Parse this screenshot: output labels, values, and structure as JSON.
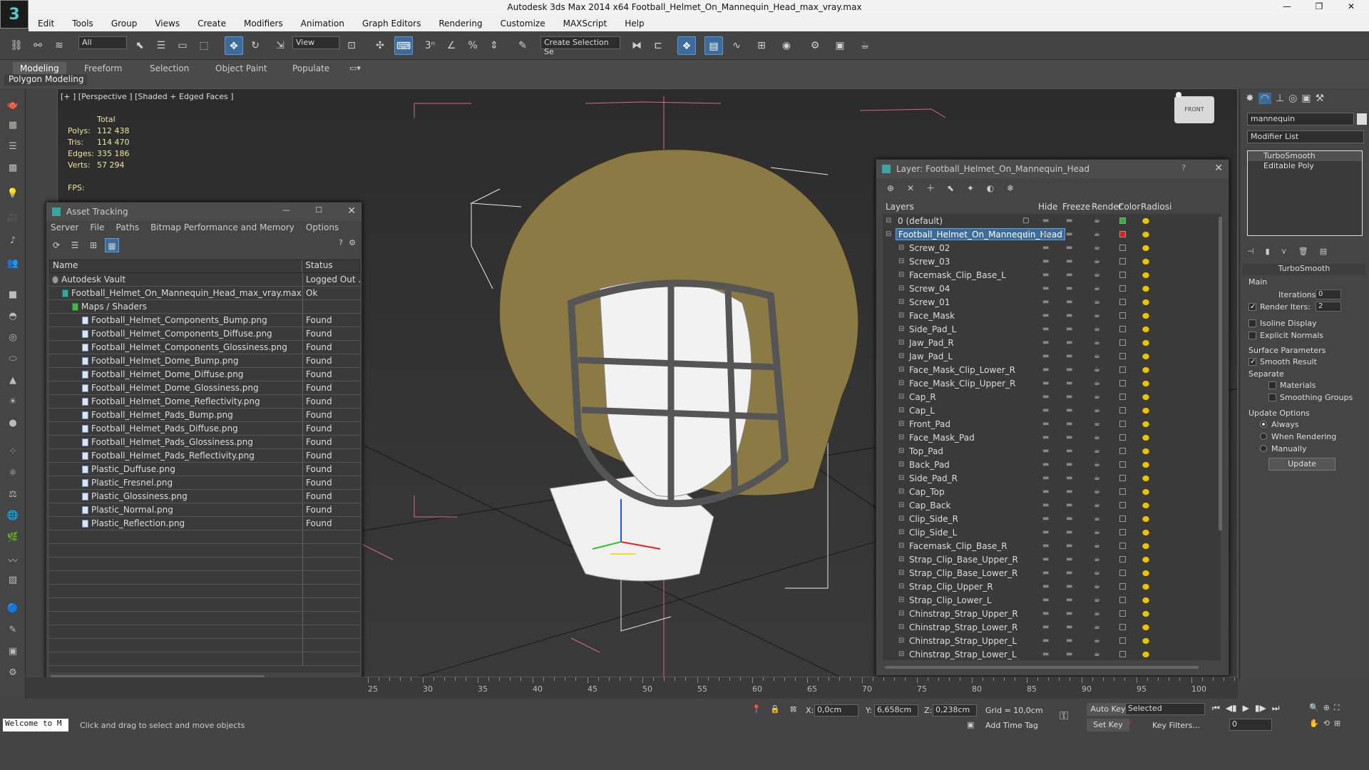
{
  "app": {
    "title": "Autodesk 3ds Max  2014 x64     Football_Helmet_On_Mannequin_Head_max_vray.max",
    "logo": "3"
  },
  "menu": [
    "Edit",
    "Tools",
    "Group",
    "Views",
    "Create",
    "Modifiers",
    "Animation",
    "Graph Editors",
    "Rendering",
    "Customize",
    "MAXScript",
    "Help"
  ],
  "toolbar": {
    "selection_filter": "All",
    "reference_coord": "View",
    "named_selection": "Create Selection Se"
  },
  "ribbon": {
    "tabs": [
      "Modeling",
      "Freeform",
      "Selection",
      "Object Paint",
      "Populate"
    ],
    "active_tab": "Modeling",
    "panel_label": "Polygon Modeling"
  },
  "viewport": {
    "label": "[+ ] [Perspective ] [Shaded + Edged Faces ]",
    "stats": {
      "header": "Total",
      "polys_label": "Polys:",
      "polys": "112 438",
      "tris_label": "Tris:",
      "tris": "114 470",
      "edges_label": "Edges:",
      "edges": "335 186",
      "verts_label": "Verts:",
      "verts": "57 294",
      "fps_label": "FPS:"
    },
    "viewcube_label": "FRONT"
  },
  "asset_tracking": {
    "title": "Asset Tracking",
    "menu": [
      "Server",
      "File",
      "Paths",
      "Bitmap Performance and Memory",
      "Options"
    ],
    "columns": [
      "Name",
      "Status"
    ],
    "rows": [
      {
        "name": "Autodesk Vault",
        "status": "Logged Out ...",
        "indent": 1
      },
      {
        "name": "Football_Helmet_On_Mannequin_Head_max_vray.max",
        "status": "Ok",
        "indent": 2
      },
      {
        "name": "Maps / Shaders",
        "status": "",
        "indent": 3
      },
      {
        "name": "Football_Helmet_Components_Bump.png",
        "status": "Found",
        "indent": 4
      },
      {
        "name": "Football_Helmet_Components_Diffuse.png",
        "status": "Found",
        "indent": 4
      },
      {
        "name": "Football_Helmet_Components_Glossiness.png",
        "status": "Found",
        "indent": 4
      },
      {
        "name": "Football_Helmet_Dome_Bump.png",
        "status": "Found",
        "indent": 4
      },
      {
        "name": "Football_Helmet_Dome_Diffuse.png",
        "status": "Found",
        "indent": 4
      },
      {
        "name": "Football_Helmet_Dome_Glossiness.png",
        "status": "Found",
        "indent": 4
      },
      {
        "name": "Football_Helmet_Dome_Reflectivity.png",
        "status": "Found",
        "indent": 4
      },
      {
        "name": "Football_Helmet_Pads_Bump.png",
        "status": "Found",
        "indent": 4
      },
      {
        "name": "Football_Helmet_Pads_Diffuse.png",
        "status": "Found",
        "indent": 4
      },
      {
        "name": "Football_Helmet_Pads_Glossiness.png",
        "status": "Found",
        "indent": 4
      },
      {
        "name": "Football_Helmet_Pads_Reflectivity.png",
        "status": "Found",
        "indent": 4
      },
      {
        "name": "Plastic_Duffuse.png",
        "status": "Found",
        "indent": 4
      },
      {
        "name": "Plastic_Fresnel.png",
        "status": "Found",
        "indent": 4
      },
      {
        "name": "Plastic_Glossiness.png",
        "status": "Found",
        "indent": 4
      },
      {
        "name": "Plastic_Normal.png",
        "status": "Found",
        "indent": 4
      },
      {
        "name": "Plastic_Reflection.png",
        "status": "Found",
        "indent": 4
      }
    ]
  },
  "layers": {
    "title": "Layer: Football_Helmet_On_Mannequin_Head",
    "columns": [
      "Layers",
      "Hide",
      "Freeze",
      "Render",
      "Color",
      "Radiosi"
    ],
    "rows": [
      {
        "name": "0 (default)",
        "level": 0,
        "color": "#2bb52b"
      },
      {
        "name": "Football_Helmet_On_Mannequin_Head",
        "level": 0,
        "color": "#d42020",
        "selected": true
      },
      {
        "name": "Screw_02",
        "level": 1
      },
      {
        "name": "Screw_03",
        "level": 1
      },
      {
        "name": "Facemask_Clip_Base_L",
        "level": 1
      },
      {
        "name": "Screw_04",
        "level": 1
      },
      {
        "name": "Screw_01",
        "level": 1
      },
      {
        "name": "Face_Mask",
        "level": 1
      },
      {
        "name": "Side_Pad_L",
        "level": 1
      },
      {
        "name": "Jaw_Pad_R",
        "level": 1
      },
      {
        "name": "Jaw_Pad_L",
        "level": 1
      },
      {
        "name": "Face_Mask_Clip_Lower_R",
        "level": 1
      },
      {
        "name": "Face_Mask_Clip_Upper_R",
        "level": 1
      },
      {
        "name": "Cap_R",
        "level": 1
      },
      {
        "name": "Cap_L",
        "level": 1
      },
      {
        "name": "Front_Pad",
        "level": 1
      },
      {
        "name": "Face_Mask_Pad",
        "level": 1
      },
      {
        "name": "Top_Pad",
        "level": 1
      },
      {
        "name": "Back_Pad",
        "level": 1
      },
      {
        "name": "Side_Pad_R",
        "level": 1
      },
      {
        "name": "Cap_Top",
        "level": 1
      },
      {
        "name": "Cap_Back",
        "level": 1
      },
      {
        "name": "Clip_Side_R",
        "level": 1
      },
      {
        "name": "Clip_Side_L",
        "level": 1
      },
      {
        "name": "Facemask_Clip_Base_R",
        "level": 1
      },
      {
        "name": "Strap_Clip_Base_Upper_R",
        "level": 1
      },
      {
        "name": "Strap_Clip_Base_Lower_R",
        "level": 1
      },
      {
        "name": "Strap_Clip_Upper_R",
        "level": 1
      },
      {
        "name": "Strap_Clip_Lower_L",
        "level": 1
      },
      {
        "name": "Chinstrap_Strap_Upper_R",
        "level": 1
      },
      {
        "name": "Chinstrap_Strap_Lower_R",
        "level": 1
      },
      {
        "name": "Chinstrap_Strap_Upper_L",
        "level": 1
      },
      {
        "name": "Chinstrap_Strap_Lower_L",
        "level": 1
      }
    ]
  },
  "command_panel": {
    "object_name": "mannequin",
    "modifier_list": "Modifier List",
    "stack": [
      "TurboSmooth",
      "Editable Poly"
    ],
    "turbosmooth": {
      "title": "TurboSmooth",
      "main": "Main",
      "iterations_label": "Iterations:",
      "iterations": "0",
      "render_iters_label": "Render Iters:",
      "render_iters": "2",
      "isoline": "Isoline Display",
      "explicit": "Explicit Normals",
      "surface": "Surface Parameters",
      "smooth_result": "Smooth Result",
      "separate": "Separate",
      "materials": "Materials",
      "smoothing_groups": "Smoothing Groups",
      "update_options": "Update Options",
      "always": "Always",
      "when_rendering": "When Rendering",
      "manually": "Manually",
      "update_btn": "Update"
    }
  },
  "timeline": {
    "ticks": [
      "25",
      "30",
      "35",
      "40",
      "45",
      "50",
      "55",
      "60",
      "65",
      "70",
      "75",
      "80",
      "85",
      "90",
      "95",
      "100"
    ]
  },
  "status": {
    "maxscript": "Welcome to M",
    "prompt": "Click and drag to select and move objects",
    "x_label": "X:",
    "x": "0,0cm",
    "y_label": "Y:",
    "y": "6,658cm",
    "z_label": "Z:",
    "z": "0,238cm",
    "grid": "Grid = 10,0cm",
    "add_time_tag": "Add Time Tag",
    "auto_key": "Auto Key",
    "set_key": "Set Key",
    "selected": "Selected",
    "key_filters": "Key Filters...",
    "frame": "0"
  }
}
